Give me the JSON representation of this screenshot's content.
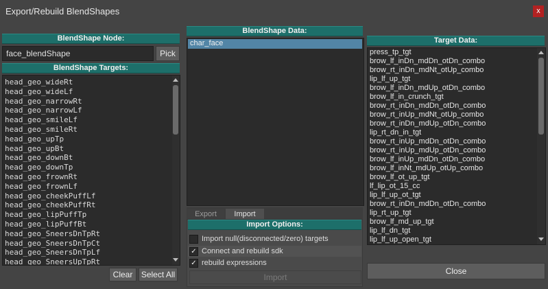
{
  "window": {
    "title": "Export/Rebuild BlendShapes",
    "close_label": "x"
  },
  "left": {
    "node_header": "BlendShape Node:",
    "node_value": "face_blendShape",
    "pick_label": "Pick",
    "targets_header": "BlendShape Targets:",
    "targets": [
      "head_geo_wideRt",
      "head_geo_wideLf",
      "head_geo_narrowRt",
      "head_geo_narrowLf",
      "head_geo_smileLf",
      "head_geo_smileRt",
      "head_geo_upTp",
      "head_geo_upBt",
      "head_geo_downBt",
      "head_geo_downTp",
      "head_geo_frownRt",
      "head_geo_frownLf",
      "head_geo_cheekPuffLf",
      "head_geo_cheekPuffRt",
      "head_geo_lipPuffTp",
      "head_geo_lipPuffBt",
      "head_geo_SneersDnTpRt",
      "head_geo_SneersDnTpCt",
      "head_geo_SneersDnTpLf",
      "head_geo_SneersUpTpRt"
    ],
    "clear_label": "Clear",
    "select_all_label": "Select All"
  },
  "middle": {
    "data_header": "BlendShape Data:",
    "data_items": [
      "char_face"
    ],
    "tabs": [
      "Export",
      "Import"
    ],
    "options_header": "Import Options:",
    "options": [
      {
        "label": "Import null(disconnected/zero) targets",
        "checked": false
      },
      {
        "label": "Connect and rebuild sdk",
        "checked": true
      },
      {
        "label": "rebuild expressions",
        "checked": true
      }
    ],
    "import_label": "Import"
  },
  "right": {
    "target_header": "Target Data:",
    "targets": [
      "press_tp_tgt",
      "brow_lf_inDn_mdDn_otDn_combo",
      "brow_rt_inDn_mdNt_otUp_combo",
      "lip_lf_up_tgt",
      "brow_lf_inDn_mdUp_otDn_combo",
      "brow_lf_in_crunch_tgt",
      "brow_rt_inDn_mdDn_otDn_combo",
      "brow_rt_inUp_mdNt_otUp_combo",
      "brow_rt_inDn_mdUp_otDn_combo",
      "lip_rt_dn_in_tgt",
      "brow_rt_inUp_mdDn_otDn_combo",
      "brow_rt_inUp_mdUp_otDn_combo",
      "brow_lf_inUp_mdDn_otDn_combo",
      "brow_lf_inNt_mdUp_otUp_combo",
      "brow_lf_ot_up_tgt",
      "lf_lip_ot_15_cc",
      "lip_lf_up_ot_tgt",
      "brow_rt_inDn_mdDn_otDn_combo",
      "lip_rt_up_tgt",
      "brow_lf_md_up_tgt",
      "lip_lf_dn_tgt",
      "lip_lf_up_open_tgt"
    ],
    "close_label": "Close"
  }
}
